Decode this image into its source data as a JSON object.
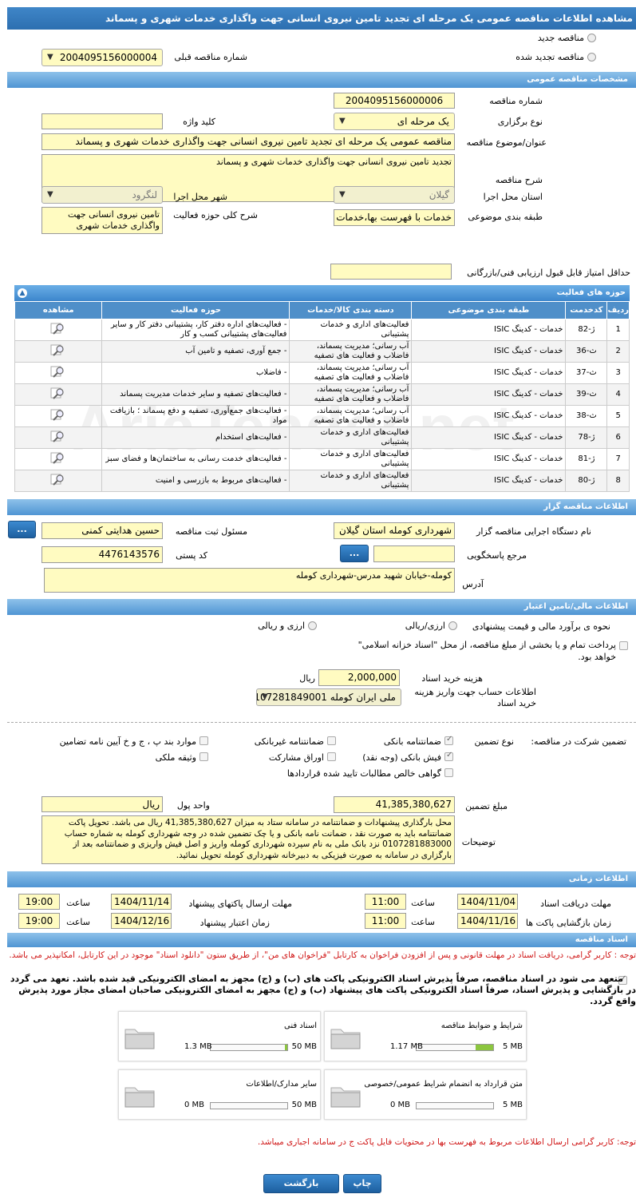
{
  "page_title": "مشاهده اطلاعات مناقصه عمومی یک مرحله ای تجدید تامین نیروی انسانی جهت واگذاری خدمات شهری و پسماند",
  "top": {
    "radio_new": "مناقصه جدید",
    "radio_renewed": "مناقصه تجدید شده",
    "prev_label": "شماره مناقصه قبلی",
    "prev_value": "2004095156000004"
  },
  "general": {
    "header": "مشخصات مناقصه عمومی",
    "number_label": "شماره مناقصه",
    "number_value": "2004095156000006",
    "type_label": "نوع برگزاری",
    "type_value": "یک مرحله ای",
    "keyword_label": "کلید واژه",
    "keyword_value": "",
    "subject_label": "عنوان/موضوع مناقصه",
    "subject_value": "مناقصه عمومی یک مرحله ای تجدید تامین نیروی انسانی جهت واگذاری خدمات شهری و پسماند",
    "desc_label": "شرح مناقصه",
    "desc_value": "تجدید تامین نیروی انسانی جهت واگذاری خدمات شهری و پسماند",
    "province_label": "استان محل اجرا",
    "province_value": "گیلان",
    "city_label": "شهر محل اجرا",
    "city_value": "لنگرود",
    "category_label": "طبقه بندی موضوعی",
    "category_value": "خدمات با فهرست بها،خدمات",
    "scope_label": "شرح کلی حوزه فعالیت",
    "scope_value": "تامین نیروی انسانی جهت واگذاری خدمات شهری",
    "min_score_label": "حداقل امتیاز قابل قبول ارزیابی فنی/بازرگانی",
    "min_score_value": ""
  },
  "activities": {
    "header": "حوزه های فعالیت",
    "columns": [
      "ردیف",
      "کدخدمت",
      "طبقه بندی موضوعی",
      "دسته بندی کالا/خدمات",
      "حوزه فعالیت",
      "مشاهده"
    ],
    "rows": [
      {
        "n": "1",
        "code": "ژ-82",
        "cat": "خدمات - کدینگ ISIC",
        "group": "فعالیت‌های اداری و خدمات پشتیبانی",
        "area": "- فعالیت‌های  اداره دفتر کار، پشتیبانی دفتر کار و سایر  فعالیت‌های پشتیبانی کسب و کار"
      },
      {
        "n": "2",
        "code": "ث-36",
        "cat": "خدمات - کدینگ ISIC",
        "group": "آب رسانی؛ مدیریت پسماند، فاضلاب و فعالیت های تصفیه",
        "area": "- جمع آوری، تصفیه و تامین آب"
      },
      {
        "n": "3",
        "code": "ث-37",
        "cat": "خدمات - کدینگ ISIC",
        "group": "آب رسانی؛ مدیریت پسماند، فاضلاب و فعالیت های تصفیه",
        "area": "- فاضلاب"
      },
      {
        "n": "4",
        "code": "ث-39",
        "cat": "خدمات - کدینگ ISIC",
        "group": "آب رسانی؛ مدیریت پسماند، فاضلاب و فعالیت های تصفیه",
        "area": "- فعالیت‌های تصفیه و سایر خدمات مدیریت پسماند"
      },
      {
        "n": "5",
        "code": "ث-38",
        "cat": "خدمات - کدینگ ISIC",
        "group": "آب رسانی؛ مدیریت پسماند، فاضلاب و فعالیت های تصفیه",
        "area": "- فعالیت‌های جمع‌آوری، تصفیه و دفع پسماند ؛ بازیافت مواد"
      },
      {
        "n": "6",
        "code": "ژ-78",
        "cat": "خدمات - کدینگ ISIC",
        "group": "فعالیت‌های اداری و خدمات پشتیبانی",
        "area": "- فعالیت‌های استخدام"
      },
      {
        "n": "7",
        "code": "ژ-81",
        "cat": "خدمات - کدینگ ISIC",
        "group": "فعالیت‌های اداری و خدمات پشتیبانی",
        "area": "- فعالیت‌های خدمت رسانی به ساختمان‌ها و فضای سبز"
      },
      {
        "n": "8",
        "code": "ژ-80",
        "cat": "خدمات - کدینگ ISIC",
        "group": "فعالیت‌های اداری و خدمات پشتیبانی",
        "area": "- فعالیت‌های مربوط به بازرسی و امنیت"
      }
    ]
  },
  "organizer": {
    "header": "اطلاعات مناقصه گزار",
    "org_label": "نام دستگاه اجرایی مناقصه گزار",
    "org_value": "شهرداری کومله استان گیلان",
    "resp_label": "مسئول ثبت مناقصه",
    "resp_value": "حسین هدایتی کمنی",
    "ref_label": "مرجع پاسخگویی",
    "ref_value": "",
    "postal_label": "کد پستی",
    "postal_value": "4476143576",
    "address_label": "آدرس",
    "address_value": "کومله-خیابان شهید مدرس-شهرداری کومله",
    "dots": "..."
  },
  "finance": {
    "header": "اطلاعات مالی/تامین اعتبار",
    "estimate_label": "نحوه ی برآورد مالی و قیمت پیشنهادی",
    "opt1": "ارزی/ریالی",
    "opt2": "ارزی و ریالی",
    "payment_text": "پرداخت تمام و یا بخشی از مبلغ مناقصه، از محل \"اسناد خزانه اسلامی\" خواهد بود.",
    "doc_fee_label": "هزینه خرید اسناد",
    "doc_fee_value": "2,000,000",
    "doc_fee_unit": "ریال",
    "account_label": "اطلاعات حساب جهت واریز هزینه خرید اسناد",
    "account_value": "ملی ایران کومله 0107281849001"
  },
  "guarantee": {
    "title": "تضمین شرکت در مناقصه:",
    "type_label": "نوع تضمین",
    "opts": [
      "ضمانتنامه بانکی",
      "ضمانتنامه غیربانکی",
      "موارد بند پ ، ج و خ آیین نامه تضامین",
      "فیش بانکی (وجه نقد)",
      "اوراق مشارکت",
      "وثیقه ملکی",
      "گواهی خالص مطالبات تایید شده قراردادها"
    ],
    "amount_label": "مبلغ تضمین",
    "amount_value": "41,385,380,627",
    "currency_label": "واحد پول",
    "currency_value": "ریال",
    "notes_label": "توضیحات",
    "notes_value": "محل بارگذاری پیشنهادات و ضمانتنامه در سامانه ستاد به میزان 41,385,380,627 ریال می باشد. تحویل پاکت ضمانتنامه باید به صورت نقد ، ضمانت نامه بانکی و یا چک تضمین شده در وجه شهرداری کومله به شماره حساب 0107281883000 نزد بانک ملی به نام سپرده شهرداری کومله واریز و اصل فیش واریزی و ضمانتنامه بعد از بارگزاری در سامانه به صورت فیزیکی به دبیرخانه شهرداری کومله تحویل نمائید."
  },
  "timing": {
    "header": "اطلاعات زمانی",
    "receive_label": "مهلت دریافت اسناد",
    "receive_date": "1404/11/04",
    "receive_time": "11:00",
    "send_label": "مهلت ارسال پاکتهای پیشنهاد",
    "send_date": "1404/11/14",
    "send_time": "19:00",
    "open_label": "زمان بازگشایی پاکت ها",
    "open_date": "1404/11/16",
    "open_time": "11:00",
    "valid_label": "زمان اعتبار پیشنهاد",
    "valid_date": "1404/12/16",
    "valid_time": "19:00",
    "time_label": "ساعت"
  },
  "docs": {
    "header": "اسناد مناقصه",
    "notice": "توجه : کاربر گرامی، دریافت اسناد در مهلت قانونی و پس از افزودن فراخوان به کارتابل \"فراخوان های من\"، از طریق ستون \"دانلود اسناد\" موجود در این کارتابل، امکانپذیر می باشد.",
    "commit": "متعهد می شود در اسناد مناقصه، صرفاً پذیرش اسناد الکترونیکی پاکت های (ب) و (ج) مجهز به امضای الکترونیکی قید شده باشد. تعهد می گردد در بازگشایی و پذیرش اسناد، صرفاً اسناد الکترونیکی پاکت های پیشنهاد (ب) و (ج) مجهز به امضای الکترونیکی صاحبان امضای مجاز مورد پذیرش واقع گردد.",
    "items": [
      {
        "name": "شرایط و ضوابط مناقصه",
        "used": "1.17 MB",
        "max": "5 MB",
        "pct": 23
      },
      {
        "name": "اسناد فنی",
        "used": "1.3 MB",
        "max": "50 MB",
        "pct": 3
      },
      {
        "name": "متن قرارداد به انضمام شرایط عمومی/خصوصی",
        "used": "0 MB",
        "max": "5 MB",
        "pct": 0
      },
      {
        "name": "سایر مدارک/اطلاعات",
        "used": "0 MB",
        "max": "50 MB",
        "pct": 0
      }
    ],
    "footer_note": "توجه: کاربر گرامی ارسال اطلاعات مربوط به فهرست بها در محتویات فایل پاکت ج در سامانه اجباری میباشد."
  },
  "actions": {
    "back": "بازگشت",
    "print": "چاپ"
  },
  "watermark": "AriaTender.net"
}
